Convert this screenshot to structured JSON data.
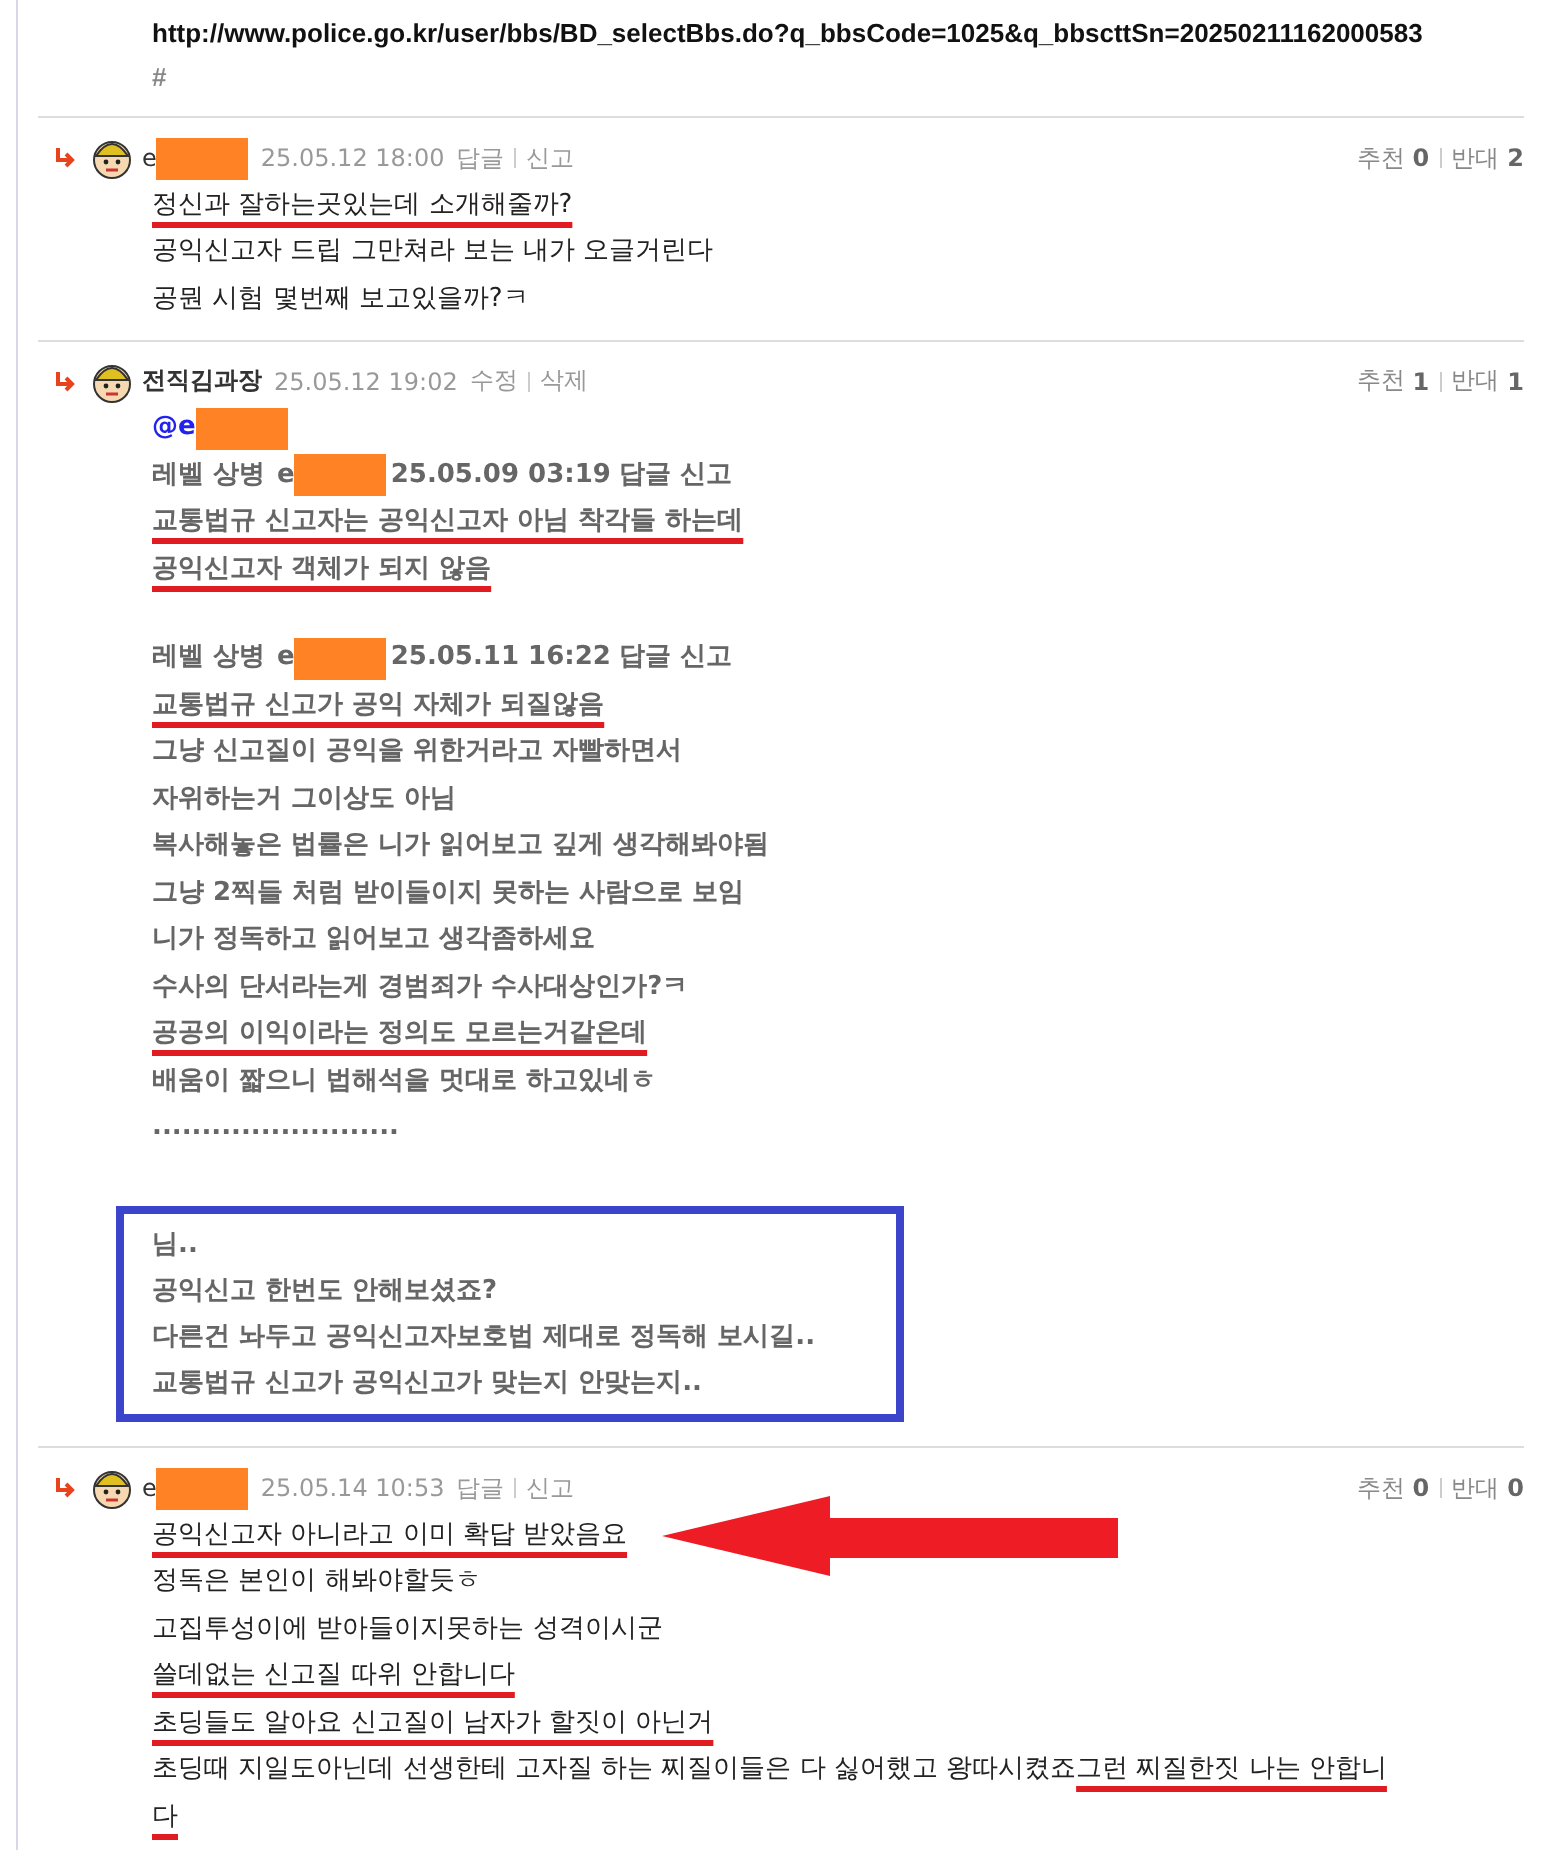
{
  "link": {
    "url": "http://www.police.go.kr/user/bbs/BD_selectBbs.do?q_bbsCode=1025&q_bbscttSn=20250211162000583",
    "hash": "#"
  },
  "comments": [
    {
      "author": "e",
      "author_bold": false,
      "redacted": true,
      "date": "25.05.12 18:00",
      "actions": [
        "답글",
        "신고"
      ],
      "up_label": "추천",
      "up": "0",
      "down_label": "반대",
      "down": "2",
      "body": [
        {
          "kind": "line",
          "arrow": false,
          "segments": [
            {
              "text": "정신과 잘하는곳있는데 소개해줄까?",
              "underlined": true
            }
          ]
        },
        {
          "kind": "line",
          "arrow": false,
          "segments": [
            {
              "text": "공익신고자 드립 그만쳐라 보는 내가 오글거린다",
              "underlined": false
            }
          ]
        },
        {
          "kind": "line",
          "arrow": false,
          "segments": [
            {
              "text": "공뭔 시험 몇번째 보고있을까?ㅋ",
              "underlined": false
            }
          ]
        }
      ]
    },
    {
      "author": "전직김과장",
      "author_bold": true,
      "redacted": false,
      "date": "25.05.12 19:02",
      "actions": [
        "수정",
        "삭제"
      ],
      "up_label": "추천",
      "up": "1",
      "down_label": "반대",
      "down": "1",
      "body": [
        {
          "kind": "mention",
          "text": "@e",
          "redacted": true
        },
        {
          "kind": "quote_header",
          "level": "레벨 상병",
          "author": "e",
          "redacted": true,
          "date": "25.05.09 03:19",
          "actions": "답글 신고"
        },
        {
          "kind": "quote",
          "segments": [
            {
              "text": "교통법규 신고자는 공익신고자 아님 착각들 하는데",
              "underlined": true
            }
          ]
        },
        {
          "kind": "quote",
          "segments": [
            {
              "text": "공익신고자 객체가 되지 않음",
              "underlined": true
            }
          ]
        },
        {
          "kind": "blank"
        },
        {
          "kind": "quote_header",
          "level": "레벨 상병",
          "author": "e",
          "redacted": true,
          "date": "25.05.11 16:22",
          "actions": "답글 신고"
        },
        {
          "kind": "quote",
          "segments": [
            {
              "text": "교통법규 신고가 공익 자체가 되질않음",
              "underlined": true
            }
          ]
        },
        {
          "kind": "quote",
          "segments": [
            {
              "text": "그냥 신고질이 공익을 위한거라고 자빨하면서",
              "underlined": false
            }
          ]
        },
        {
          "kind": "quote",
          "segments": [
            {
              "text": "자위하는거 그이상도 아님",
              "underlined": false
            }
          ]
        },
        {
          "kind": "quote",
          "segments": [
            {
              "text": "복사해놓은 법률은 니가 읽어보고 깊게 생각해봐야됨",
              "underlined": false
            }
          ]
        },
        {
          "kind": "quote",
          "segments": [
            {
              "text": "그냥 2찍들 처럼 받이들이지 못하는 사람으로 보임",
              "underlined": false
            }
          ]
        },
        {
          "kind": "quote",
          "segments": [
            {
              "text": "니가 정독하고 읽어보고 생각좀하세요",
              "underlined": false
            }
          ]
        },
        {
          "kind": "quote",
          "segments": [
            {
              "text": "수사의 단서라는게 경범죄가 수사대상인가?ㅋ",
              "underlined": false
            }
          ]
        },
        {
          "kind": "quote",
          "segments": [
            {
              "text": "공공의 이익이라는 정의도 모르는거같은데",
              "underlined": true
            }
          ]
        },
        {
          "kind": "quote",
          "segments": [
            {
              "text": "배움이 짧으니 법해석을 멋대로 하고있네ㅎ",
              "underlined": false
            }
          ]
        },
        {
          "kind": "quote",
          "segments": [
            {
              "text": ".........................",
              "underlined": false
            }
          ]
        },
        {
          "kind": "blank"
        },
        {
          "kind": "callout",
          "lines": [
            "님..",
            "공익신고 한번도 안해보셨죠?",
            "다른건 놔두고 공익신고자보호법 제대로 정독해 보시길..",
            "교통법규 신고가 공익신고가 맞는지 안맞는지.."
          ]
        }
      ]
    },
    {
      "author": "e",
      "author_bold": false,
      "redacted": true,
      "date": "25.05.14 10:53",
      "actions": [
        "답글",
        "신고"
      ],
      "up_label": "추천",
      "up": "0",
      "down_label": "반대",
      "down": "0",
      "body": [
        {
          "kind": "line",
          "arrow": true,
          "segments": [
            {
              "text": "공익신고자 아니라고 이미 확답 받았음요",
              "underlined": true
            }
          ]
        },
        {
          "kind": "line",
          "arrow": false,
          "segments": [
            {
              "text": "정독은 본인이 해봐야할듯ㅎ",
              "underlined": false
            }
          ]
        },
        {
          "kind": "line",
          "arrow": false,
          "segments": [
            {
              "text": "고집투성이에 받아들이지못하는 성격이시군",
              "underlined": false
            }
          ]
        },
        {
          "kind": "line",
          "arrow": false,
          "segments": [
            {
              "text": "쓸데없는 신고질 따위 안합니다",
              "underlined": true
            }
          ]
        },
        {
          "kind": "line",
          "arrow": false,
          "segments": [
            {
              "text": "초딩들도 알아요 신고질이 남자가 할짓이 아닌거",
              "underlined": true
            }
          ]
        },
        {
          "kind": "line",
          "arrow": false,
          "segments": [
            {
              "text": "초딩때 지일도아닌데 선생한테 고자질 하는 찌질이들은 다 싫어했고 왕따시켰죠 ",
              "underlined": false
            },
            {
              "text": "그런 찌질한짓 나는 안합니",
              "underlined": true
            }
          ]
        },
        {
          "kind": "line",
          "arrow": false,
          "segments": [
            {
              "text": "다",
              "underlined": true
            }
          ]
        }
      ]
    }
  ]
}
